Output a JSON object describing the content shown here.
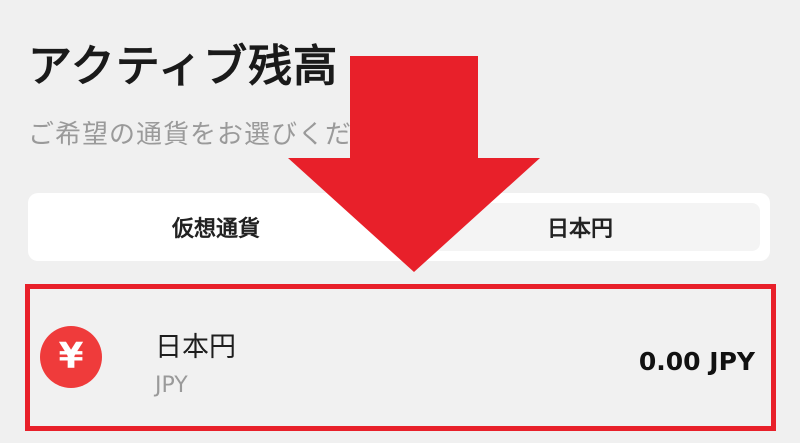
{
  "header": {
    "title": "アクティブ残高",
    "subtitle": "ご希望の通貨をお選びください"
  },
  "tabs": [
    {
      "label": "仮想通貨",
      "selected": false
    },
    {
      "label": "日本円",
      "selected": true
    }
  ],
  "asset": {
    "icon": "yen-icon",
    "icon_glyph": "¥",
    "name": "日本円",
    "code": "JPY",
    "balance": "0.00 JPY"
  },
  "annotation": {
    "arrow_color": "#e8202a",
    "highlight_color": "#e8202a"
  },
  "colors": {
    "background": "#f0f0f0",
    "yen_icon": "#ef3b3b"
  }
}
